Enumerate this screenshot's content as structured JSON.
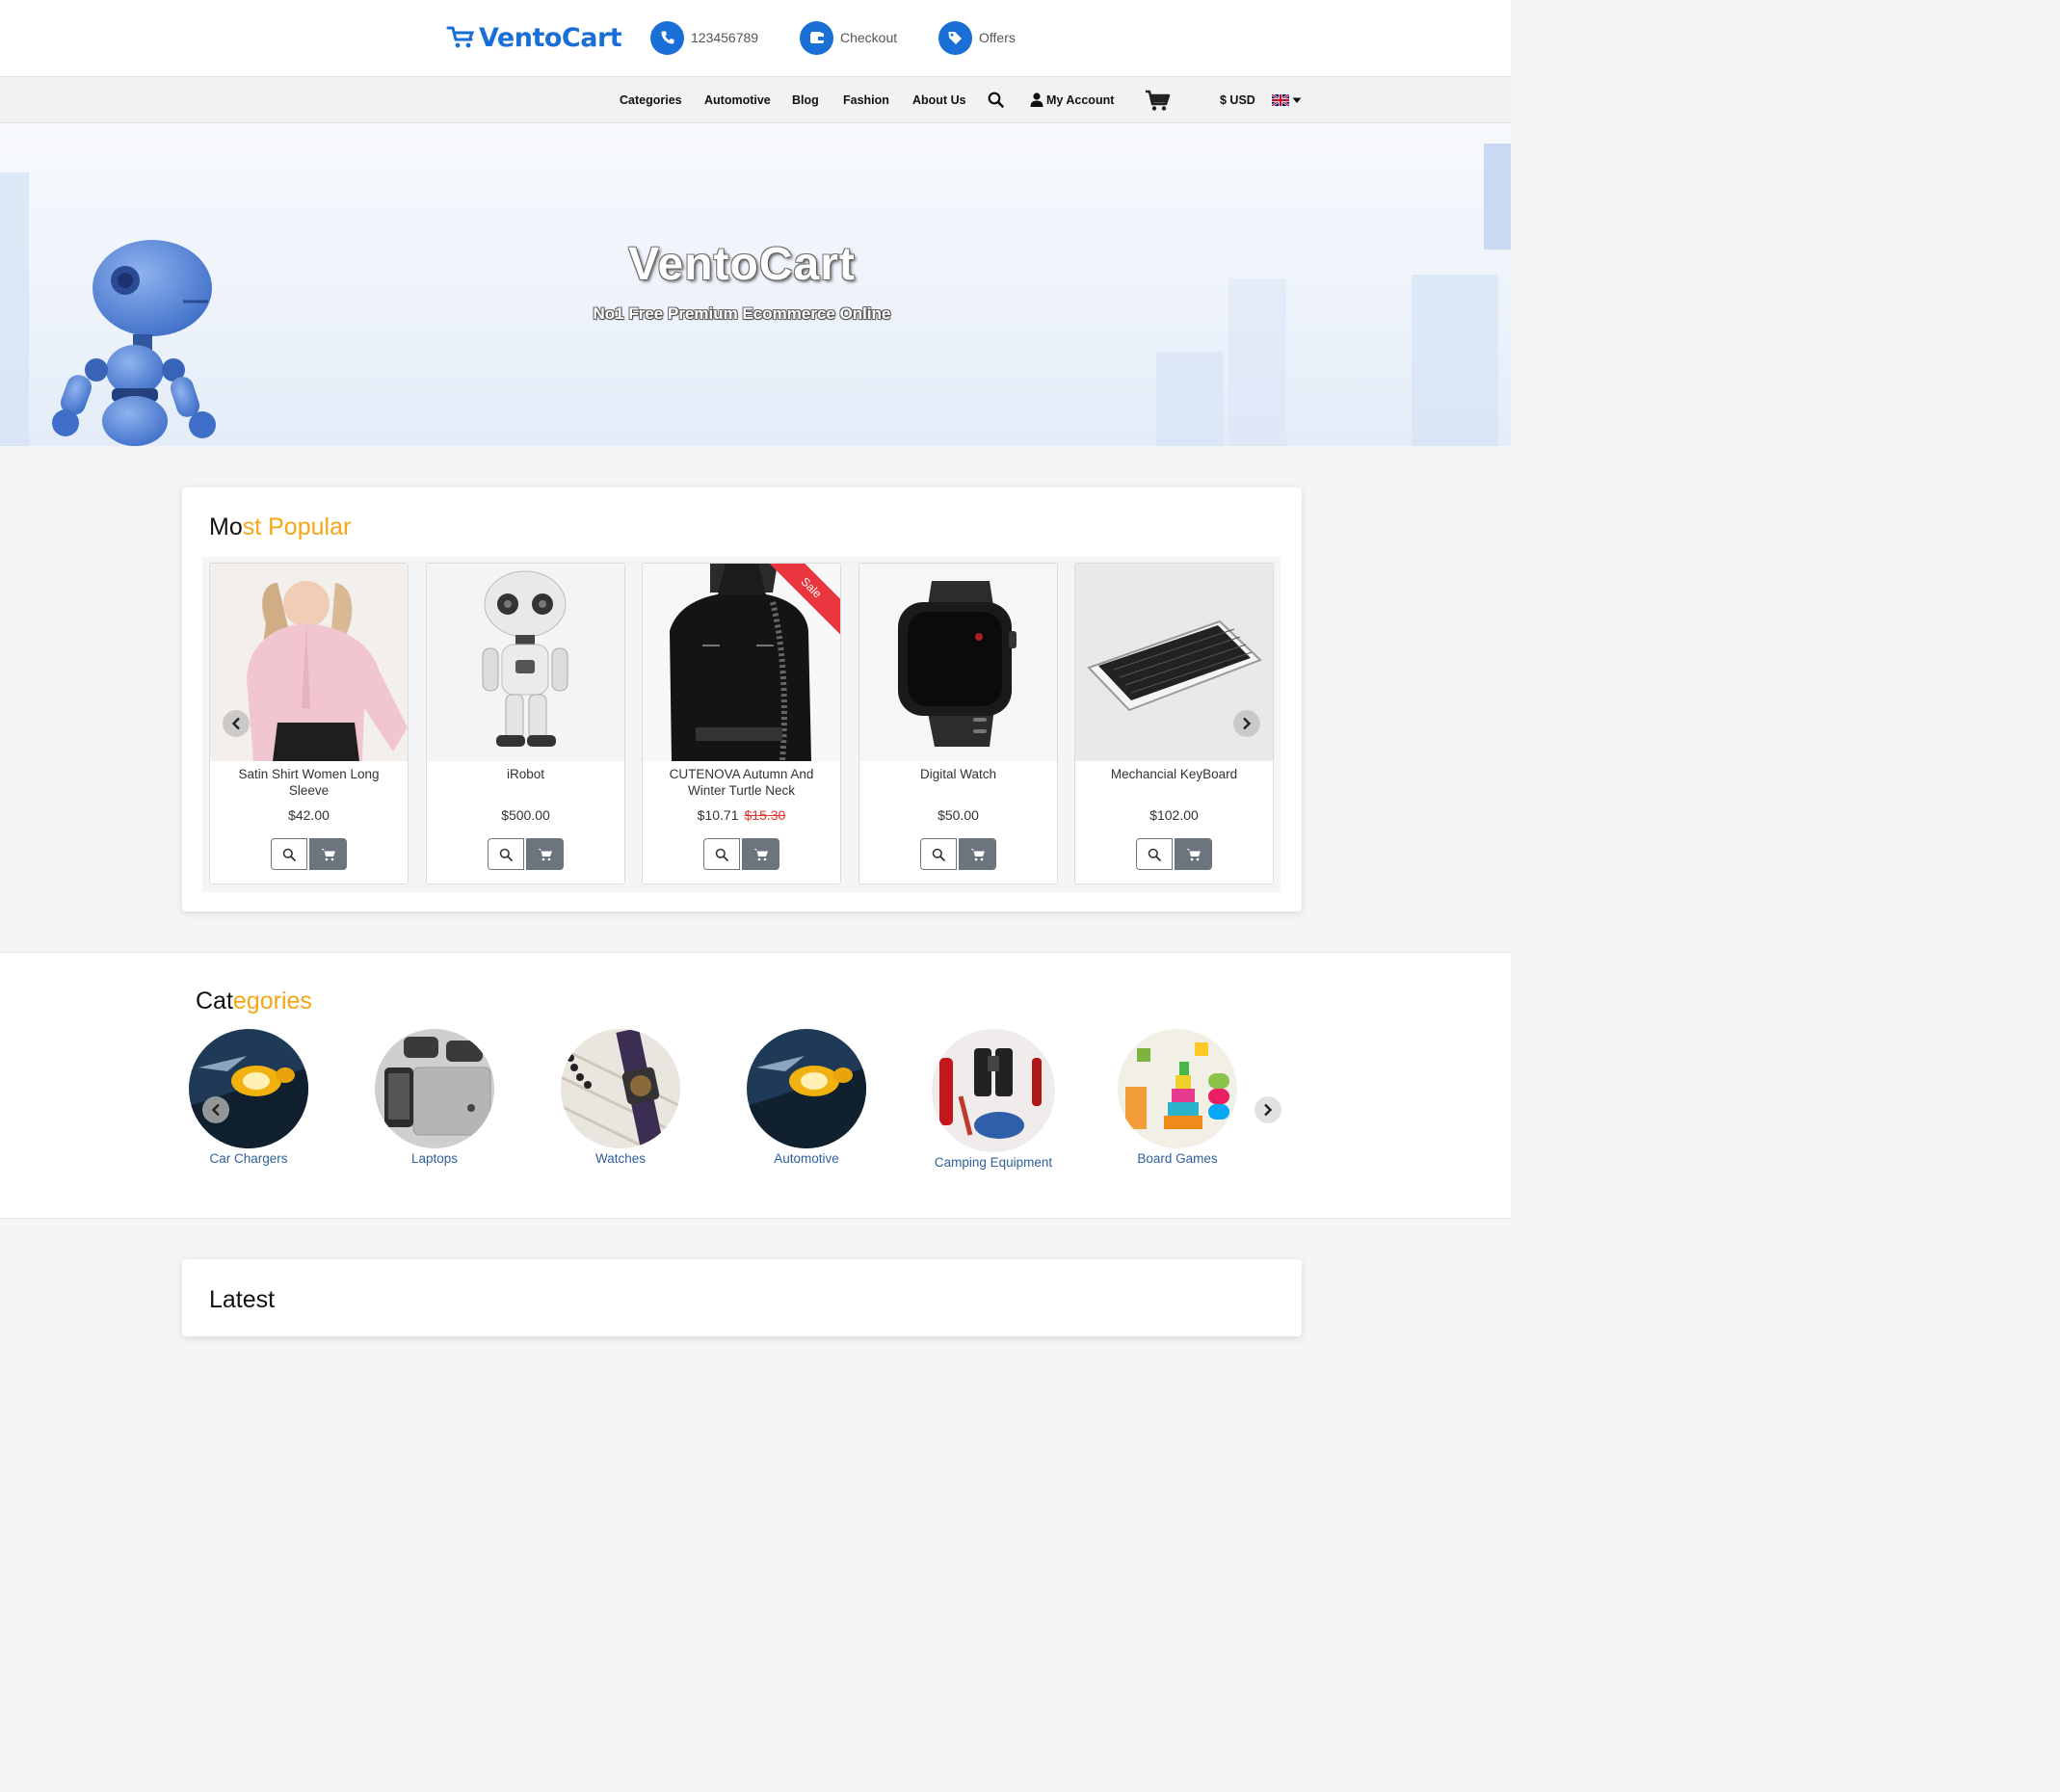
{
  "header": {
    "brand": "VentoCart",
    "phone": "123456789",
    "checkout": "Checkout",
    "offers": "Offers"
  },
  "nav": {
    "items": [
      "Categories",
      "Automotive",
      "Blog",
      "Fashion",
      "About Us"
    ],
    "account": "My Account",
    "currency": "$ USD"
  },
  "hero": {
    "title": "VentoCart",
    "subtitle": "No1 Free Premium Ecommerce Online"
  },
  "popular": {
    "title_dark": "Mo",
    "title_accent": "st Popular",
    "products": [
      {
        "name": "Satin Shirt Women Long Sleeve",
        "price": "$42.00",
        "old_price": ""
      },
      {
        "name": "iRobot",
        "price": "$500.00",
        "old_price": ""
      },
      {
        "name": "CUTENOVA Autumn And Winter Turtle Neck",
        "price": "$10.71",
        "old_price": "$15.30",
        "badge": "Sale"
      },
      {
        "name": "Digital Watch",
        "price": "$50.00",
        "old_price": ""
      },
      {
        "name": "Mechancial KeyBoard",
        "price": "$102.00",
        "old_price": ""
      }
    ]
  },
  "categories": {
    "title_dark": "Cat",
    "title_accent": "egories",
    "items": [
      "Car Chargers",
      "Laptops",
      "Watches",
      "Automotive",
      "Camping Equipment",
      "Board Games"
    ]
  },
  "latest": {
    "title": "Latest"
  },
  "colors": {
    "brand": "#1a6fd6",
    "accent": "#f5a614",
    "sale": "#e8353e"
  }
}
